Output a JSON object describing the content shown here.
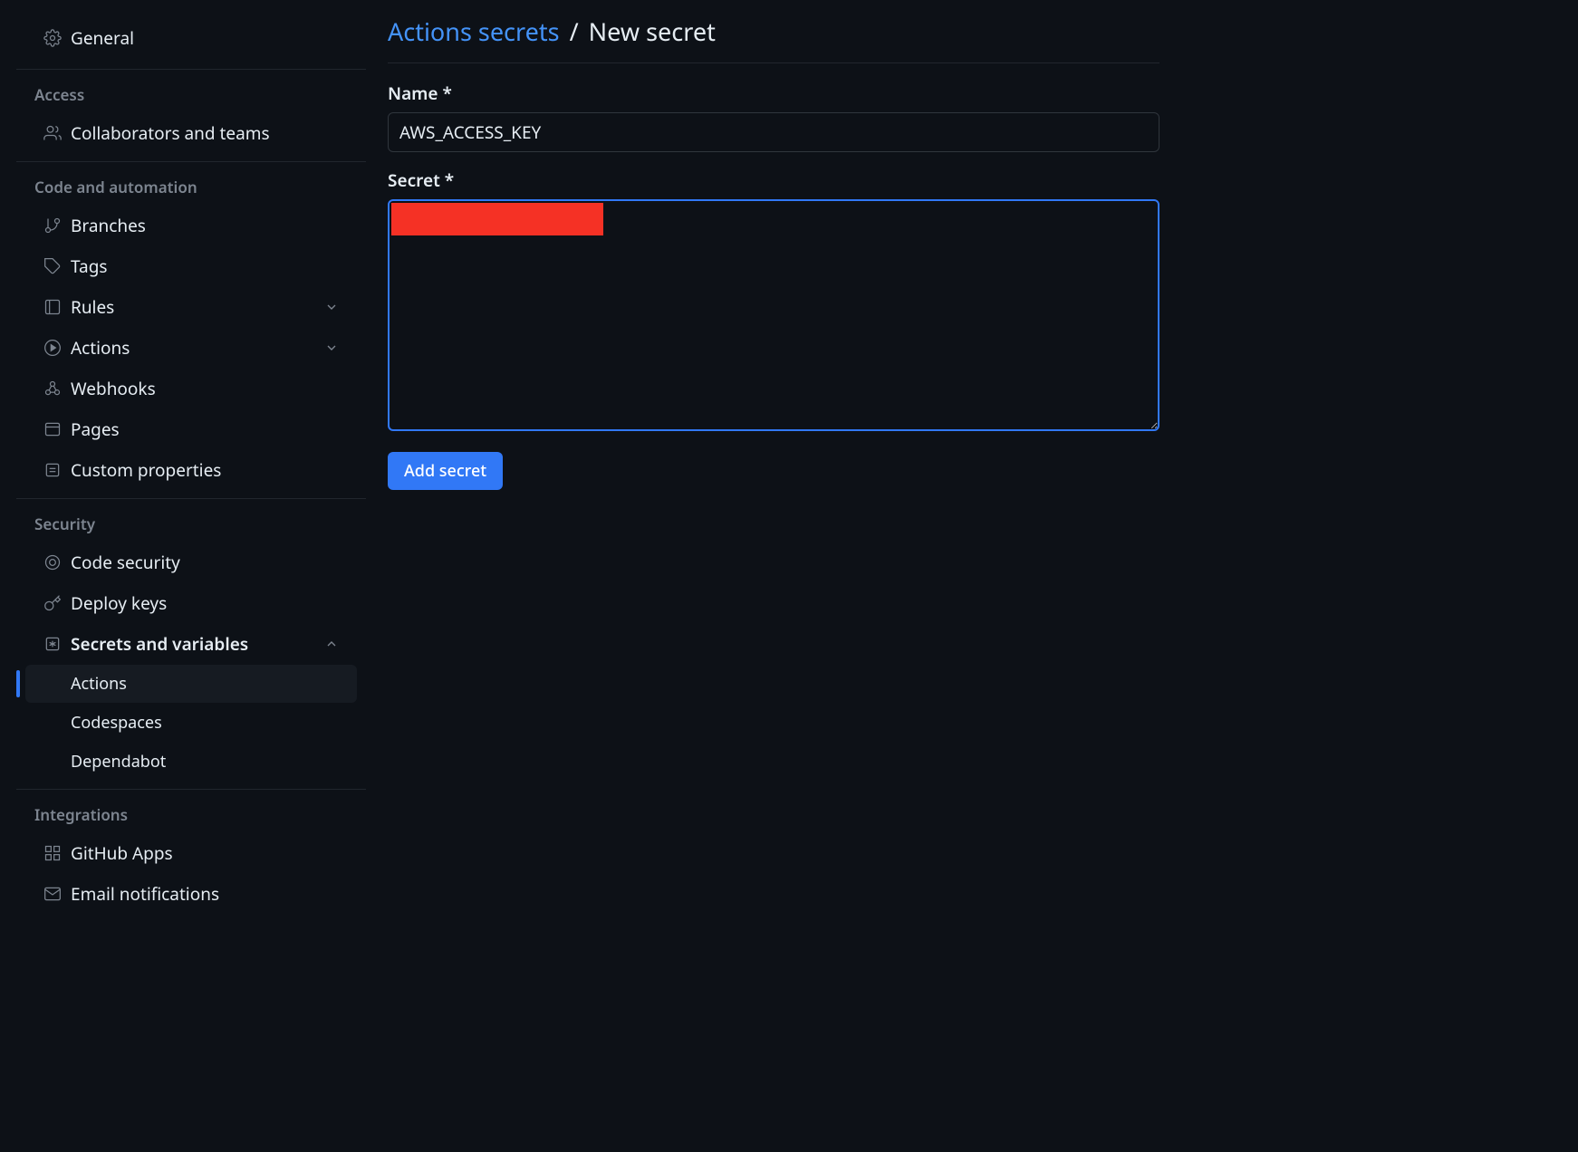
{
  "sidebar": {
    "top_item": {
      "label": "General"
    },
    "sections": [
      {
        "heading": "Access",
        "items": [
          {
            "label": "Collaborators and teams"
          }
        ]
      },
      {
        "heading": "Code and automation",
        "items": [
          {
            "label": "Branches"
          },
          {
            "label": "Tags"
          },
          {
            "label": "Rules"
          },
          {
            "label": "Actions"
          },
          {
            "label": "Webhooks"
          },
          {
            "label": "Pages"
          },
          {
            "label": "Custom properties"
          }
        ]
      },
      {
        "heading": "Security",
        "items": [
          {
            "label": "Code security"
          },
          {
            "label": "Deploy keys"
          },
          {
            "label": "Secrets and variables"
          }
        ],
        "subitems": [
          {
            "label": "Actions"
          },
          {
            "label": "Codespaces"
          },
          {
            "label": "Dependabot"
          }
        ]
      },
      {
        "heading": "Integrations",
        "items": [
          {
            "label": "GitHub Apps"
          },
          {
            "label": "Email notifications"
          }
        ]
      }
    ]
  },
  "breadcrumb": {
    "parent": "Actions secrets",
    "separator": "/",
    "current": "New secret"
  },
  "form": {
    "name_label": "Name *",
    "name_value": "AWS_ACCESS_KEY",
    "secret_label": "Secret *",
    "secret_value": "",
    "submit_label": "Add secret"
  }
}
